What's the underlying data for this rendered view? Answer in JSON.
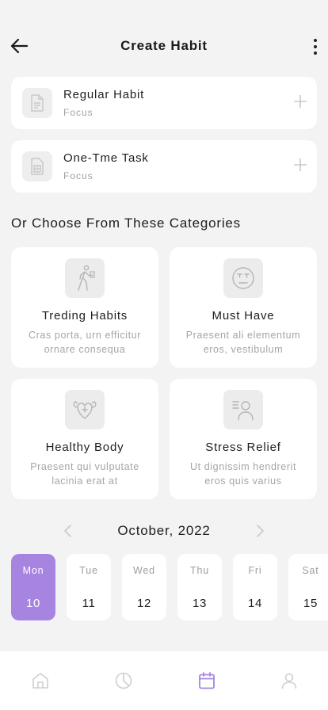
{
  "header": {
    "title": "Create Habit"
  },
  "habits": [
    {
      "name": "Regular Habit",
      "sub": "Focus",
      "icon": "document-icon"
    },
    {
      "name": "One-Tme Task",
      "sub": "Focus",
      "icon": "calculator-icon"
    }
  ],
  "section": {
    "title": "Or Choose From These Categories"
  },
  "categories": [
    {
      "name": "Treding Habits",
      "desc": "Cras porta, urn efficitur ornare consequa",
      "icon": "walking-person-icon"
    },
    {
      "name": "Must Have",
      "desc": "Praesent ali elementum eros, vestibulum",
      "icon": "face-icon"
    },
    {
      "name": "Healthy Body",
      "desc": "Praesent qui vulputate lacinia erat at",
      "icon": "strong-heart-icon"
    },
    {
      "name": "Stress Relief",
      "desc": "Ut dignissim hendrerit eros quis varius",
      "icon": "person-list-icon"
    }
  ],
  "calendar": {
    "month": "October, 2022",
    "days": [
      {
        "name": "Mon",
        "date": "10",
        "active": true
      },
      {
        "name": "Tue",
        "date": "11"
      },
      {
        "name": "Wed",
        "date": "12"
      },
      {
        "name": "Thu",
        "date": "13"
      },
      {
        "name": "Fri",
        "date": "14"
      },
      {
        "name": "Sat",
        "date": "15"
      }
    ]
  },
  "nav": {
    "items": [
      "home-icon",
      "chart-icon",
      "calendar-icon",
      "profile-icon"
    ],
    "active": "calendar-icon"
  },
  "colors": {
    "accent": "#a784e0",
    "background": "#f4f3f4",
    "card": "#ffffff",
    "muted": "#a5a5a5"
  }
}
